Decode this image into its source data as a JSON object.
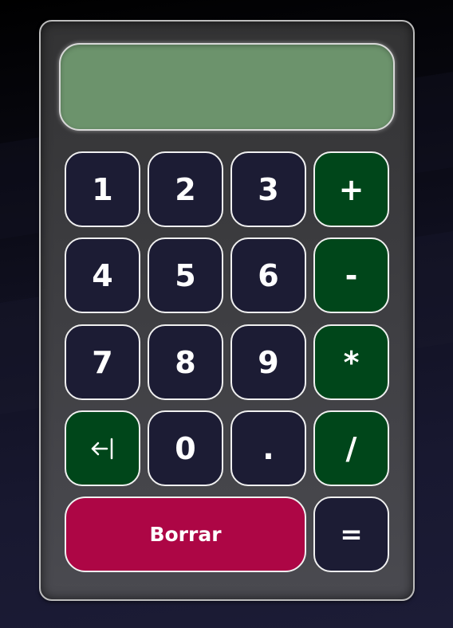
{
  "calculator": {
    "display_value": "",
    "keys": {
      "k1": "1",
      "k2": "2",
      "k3": "3",
      "k4": "4",
      "k5": "5",
      "k6": "6",
      "k7": "7",
      "k8": "8",
      "k9": "9",
      "k0": "0",
      "dot": ".",
      "plus": "+",
      "minus": "-",
      "multiply": "*",
      "divide": "/",
      "equals": "=",
      "clear": "Borrar",
      "backspace_icon": "backspace-arrow-icon"
    }
  },
  "colors": {
    "number_key": "#1c1c34",
    "operator_key": "#00461a",
    "clear_key": "#ad0645",
    "display": "#6c936c",
    "body": "#3e3e42"
  }
}
